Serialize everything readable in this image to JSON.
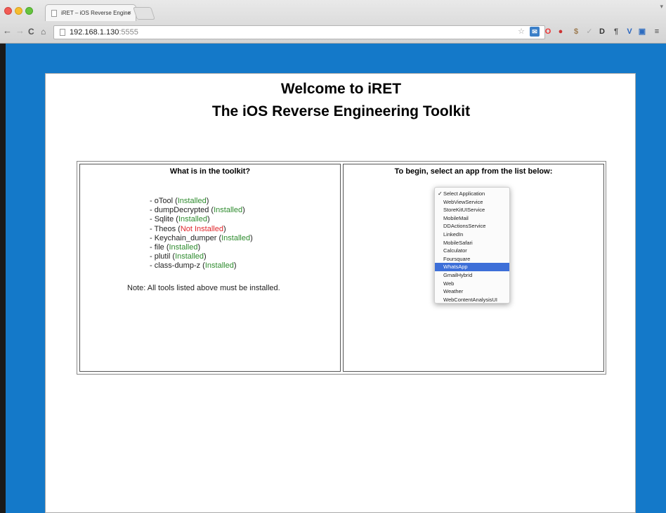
{
  "browser": {
    "tab_title": "iRET – iOS Reverse Engine",
    "tab_close": "×",
    "corner_mark": "▾",
    "url_host": "192.168.1.130",
    "url_port": ":5555"
  },
  "page": {
    "title_line1": "Welcome to iRET",
    "title_line2": "The iOS Reverse Engineering Toolkit",
    "left_header": "What is in the toolkit?",
    "right_header": "To begin, select an app from the list below:",
    "tools": [
      {
        "prefix": "- oTool (",
        "status": "Installed",
        "suffix": ")",
        "ok": true
      },
      {
        "prefix": "- dumpDecrypted (",
        "status": "Installed",
        "suffix": ")",
        "ok": true
      },
      {
        "prefix": "- Sqlite (",
        "status": "Installed",
        "suffix": ")",
        "ok": true
      },
      {
        "prefix": "- Theos (",
        "status": "Not Installed",
        "suffix": ")",
        "ok": false
      },
      {
        "prefix": "- Keychain_dumper (",
        "status": "Installed",
        "suffix": ")",
        "ok": true
      },
      {
        "prefix": "- file (",
        "status": "Installed",
        "suffix": ")",
        "ok": true
      },
      {
        "prefix": "- plutil (",
        "status": "Installed",
        "suffix": ")",
        "ok": true
      },
      {
        "prefix": "- class-dump-z (",
        "status": "Installed",
        "suffix": ")",
        "ok": true
      }
    ],
    "note": "Note: All tools listed above must be installed.",
    "app_select": {
      "checkmark": "✓",
      "options": [
        "Select Application",
        "WebViewService",
        "StoreKitUIService",
        "MobileMail",
        "DDActionsService",
        "LinkedIn",
        "MobileSafari",
        "Calculator",
        "Foursquare",
        "WhatsApp",
        "GmailHybrid",
        "Web",
        "Weather",
        "WebContentAnalysisUI"
      ],
      "checked_option": "Select Application",
      "highlighted_option": "WhatsApp"
    }
  },
  "colors": {
    "page_background": "#1479c9",
    "installed": "#2e8b2e",
    "not_installed": "#e0262b",
    "highlight": "#3d6fd8"
  }
}
